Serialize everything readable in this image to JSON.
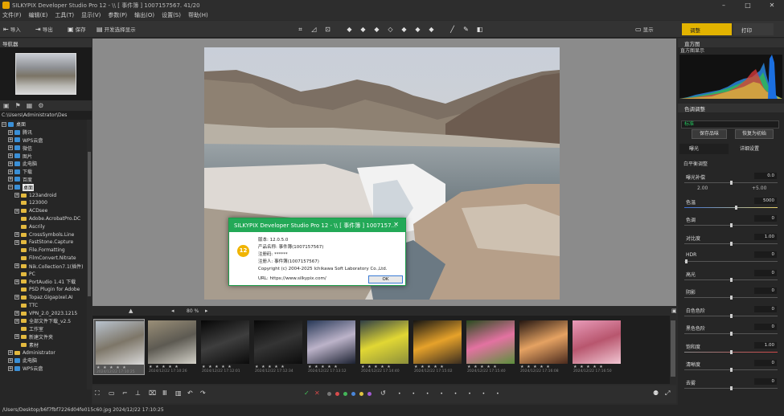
{
  "window": {
    "title": "SILKYPIX Developer Studio Pro 12 - \\\\ [ 事件簿 ] 1007157567.  41/20",
    "minimize": "–",
    "maximize": "□",
    "close": "✕"
  },
  "menu": [
    "文件(F)",
    "编辑(E)",
    "工具(T)",
    "显示(V)",
    "参数(P)",
    "输出(O)",
    "设置(S)",
    "帮助(H)"
  ],
  "toolbar": {
    "open_label": "导入",
    "export_label": "导出",
    "save_label": "保存",
    "dev_label": "开发选择显示",
    "adjust_mode": "调整",
    "print_mode": "打印",
    "mode_left": "显示"
  },
  "left": {
    "navigator_title": "导航器",
    "path": "C:\\Users\\Administrator\\Des",
    "tree": [
      {
        "label": "桌面",
        "type": "drive",
        "indent": 0,
        "exp": "−"
      },
      {
        "label": "腾讯",
        "type": "drive",
        "indent": 1,
        "exp": "+"
      },
      {
        "label": "WPS云盘",
        "type": "drive",
        "indent": 1,
        "exp": "+"
      },
      {
        "label": "微信",
        "type": "drive",
        "indent": 1,
        "exp": "+"
      },
      {
        "label": "图片",
        "type": "drive",
        "indent": 1,
        "exp": "+"
      },
      {
        "label": "此电脑",
        "type": "drive",
        "indent": 1,
        "exp": "+"
      },
      {
        "label": "下载",
        "type": "drive",
        "indent": 1,
        "exp": "+"
      },
      {
        "label": "百度",
        "type": "drive",
        "indent": 1,
        "exp": "+"
      },
      {
        "label": "桌面",
        "type": "drive",
        "indent": 1,
        "exp": "−",
        "selected": true
      },
      {
        "label": "123android",
        "type": "folder",
        "indent": 2,
        "exp": "+"
      },
      {
        "label": "123000",
        "type": "folder",
        "indent": 2,
        "exp": ""
      },
      {
        "label": "ACDsee",
        "type": "folder",
        "indent": 2,
        "exp": "+"
      },
      {
        "label": "Adobe.AcrobatPro.DC",
        "type": "folder",
        "indent": 2,
        "exp": ""
      },
      {
        "label": "Ascrily",
        "type": "folder",
        "indent": 2,
        "exp": ""
      },
      {
        "label": "CrossSymbols.Line",
        "type": "folder",
        "indent": 2,
        "exp": "+"
      },
      {
        "label": "FastStone.Capture",
        "type": "folder",
        "indent": 2,
        "exp": "+"
      },
      {
        "label": "File.Formatting",
        "type": "folder",
        "indent": 2,
        "exp": ""
      },
      {
        "label": "FilmConvert.Nitrate",
        "type": "folder",
        "indent": 2,
        "exp": ""
      },
      {
        "label": "Nik.Collection7.1(插件)",
        "type": "folder",
        "indent": 2,
        "exp": "+"
      },
      {
        "label": "PC",
        "type": "folder",
        "indent": 2,
        "exp": ""
      },
      {
        "label": "PortAudio 1.41 下载",
        "type": "folder",
        "indent": 2,
        "exp": "+"
      },
      {
        "label": "PSD Plugin for Adobe",
        "type": "folder",
        "indent": 2,
        "exp": ""
      },
      {
        "label": "Topaz.Gigapixel.AI",
        "type": "folder",
        "indent": 2,
        "exp": "+"
      },
      {
        "label": "TTC",
        "type": "folder",
        "indent": 2,
        "exp": ""
      },
      {
        "label": "VPN_2.0_2023.1215",
        "type": "folder",
        "indent": 2,
        "exp": "+"
      },
      {
        "label": "全部文件下载_v2.5",
        "type": "folder",
        "indent": 2,
        "exp": "+"
      },
      {
        "label": "工作室",
        "type": "folder",
        "indent": 2,
        "exp": ""
      },
      {
        "label": "新建文件夹",
        "type": "folder",
        "indent": 2,
        "exp": "+"
      },
      {
        "label": "素材",
        "type": "folder",
        "indent": 2,
        "exp": ""
      },
      {
        "label": "Administrator",
        "type": "folder",
        "indent": 1,
        "exp": "+"
      },
      {
        "label": "此电脑",
        "type": "drive",
        "indent": 1,
        "exp": "+"
      },
      {
        "label": "WPS云盘",
        "type": "drive",
        "indent": 1,
        "exp": "+"
      }
    ]
  },
  "viewer": {
    "zoom": "80 %"
  },
  "about": {
    "title": "SILKYPIX Developer Studio Pro 12 - \\\\ [ 事件簿 ] 1007157...",
    "close": "✕",
    "logo": "12",
    "lines": [
      "版本: 12.0.5.0",
      "产品名称: 事件簿(1007157567)",
      "注册码: ******",
      "注册人: 事件簿(1007157567)",
      "Copyright (c) 2004-2025 Ichikawa Soft Laboratory Co.,Ltd.",
      "URL: https://www.silkypix.com/"
    ],
    "ok": "OK"
  },
  "filmstrip": [
    {
      "stars": "★ ★ ★ ★ ★",
      "meta": "2024/12/22 17:10:25",
      "selected": true,
      "colors": [
        "#b9c3cf",
        "#7d7668",
        "#d9d9d9"
      ]
    },
    {
      "stars": "★ ★ ★ ★ ★",
      "meta": "2024/12/22 17:10:26",
      "colors": [
        "#9a8f78",
        "#5d5a52",
        "#d3d1c8"
      ]
    },
    {
      "stars": "★ ★ ★ ★ ★",
      "meta": "2024/12/22 17:12:01",
      "colors": [
        "#060606",
        "#3e3e3e",
        "#0b0b0b"
      ]
    },
    {
      "stars": "★ ★ ★ ★ ★",
      "meta": "2024/12/22 17:12:34",
      "colors": [
        "#070707",
        "#343434",
        "#0c0c0c"
      ]
    },
    {
      "stars": "★ ★ ★ ★ ★",
      "meta": "2024/12/22 17:13:12",
      "colors": [
        "#263756",
        "#bcb3c9",
        "#1b2131"
      ]
    },
    {
      "stars": "★ ★ ★ ★ ★",
      "meta": "2024/12/22 17:14:40",
      "colors": [
        "#2f3e45",
        "#e1d734",
        "#8c8f3a"
      ]
    },
    {
      "stars": "★ ★ ★ ★ ★",
      "meta": "2024/12/22 17:15:02",
      "colors": [
        "#161513",
        "#e6a22a",
        "#3a2d20"
      ]
    },
    {
      "stars": "★ ★ ★ ★ ★",
      "meta": "2024/12/22 17:15:40",
      "colors": [
        "#294b1f",
        "#e372a1",
        "#5c8f3c"
      ]
    },
    {
      "stars": "★ ★ ★ ★ ★",
      "meta": "2024/12/22 17:16:08",
      "colors": [
        "#241611",
        "#e5a262",
        "#4a2a1d"
      ]
    },
    {
      "stars": "★ ★ ★ ★ ★",
      "meta": "2024/12/22 17:16:50",
      "colors": [
        "#e89bb9",
        "#b8566e",
        "#f1c6d3"
      ]
    }
  ],
  "status": "/Users/Desktop/b6f7fbf7226d04fe015c60.jpg 2024/12/22 17:10:25",
  "right": {
    "panel_title": "直方图",
    "histogram_label": "直方图显示",
    "taste_title": "色调调整",
    "taste_value": "标准",
    "btn_save": "保存品味",
    "btn_reset": "恢复为初始",
    "tab_left": "曝光",
    "tab_right": "详细设置",
    "section": "白平衡调整",
    "sliders": [
      {
        "label": "曝光补偿",
        "value": "0.0",
        "fraction": 0.5
      },
      {
        "label": "色温",
        "value": "5000",
        "fraction": 0.55
      },
      {
        "label": "色调",
        "value": "0",
        "fraction": 0.5
      },
      {
        "label": "对比度",
        "value": "1.00",
        "fraction": 0.5
      },
      {
        "label": "HDR",
        "value": "0",
        "fraction": 0.02
      },
      {
        "label": "高光",
        "value": "0",
        "fraction": 0.5
      },
      {
        "label": "阴影",
        "value": "0",
        "fraction": 0.5
      },
      {
        "label": "白色色阶",
        "value": "0",
        "fraction": 0.5
      },
      {
        "label": "黑色色阶",
        "value": "0",
        "fraction": 0.5
      },
      {
        "label": "饱和度",
        "value": "1.00",
        "fraction": 0.5
      },
      {
        "label": "清晰度",
        "value": "0",
        "fraction": 0.5
      },
      {
        "label": "去雾",
        "value": "0",
        "fraction": 0.5
      }
    ],
    "wb_min": "2.00",
    "wb_max": "+5.00"
  }
}
